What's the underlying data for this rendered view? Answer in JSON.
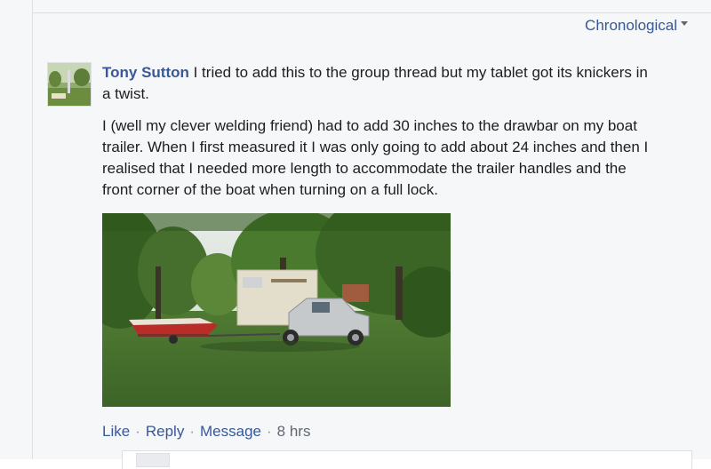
{
  "sort": {
    "label": "Chronological"
  },
  "comment": {
    "author": "Tony Sutton",
    "intro_text": " I tried to add this to the group thread but my tablet got its knickers in a twist.",
    "paragraph": "I (well my clever welding friend) had to add 30 inches to the drawbar on my boat trailer. When I first measured it I was only going to add about 24 inches and then I realised that I needed more length to accommodate the trailer handles and the front corner of the boat when turning on a full lock.",
    "actions": {
      "like": "Like",
      "reply": "Reply",
      "message": "Message",
      "separator": "·",
      "time": "8 hrs"
    }
  },
  "icons": {
    "sort_caret": "chevron-down-icon"
  }
}
